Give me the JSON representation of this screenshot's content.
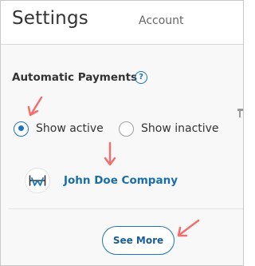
{
  "header": {
    "title": "Settings",
    "tab_account": "Account"
  },
  "automatic_payments": {
    "title": "Automatic Payments",
    "help_icon": "question-circle-icon",
    "help_glyph": "?"
  },
  "filter": {
    "options": [
      {
        "label": "Show active",
        "selected": true
      },
      {
        "label": "Show inactive",
        "selected": false
      }
    ]
  },
  "companies": [
    {
      "name": "John Doe Company",
      "logo_icon": "company-logo-icon"
    }
  ],
  "see_more_label": "See More",
  "colors": {
    "accent": "#1a75ba",
    "link": "#1a6ea8",
    "annotation": "#f07070",
    "body_background": "#f8f8f8"
  }
}
